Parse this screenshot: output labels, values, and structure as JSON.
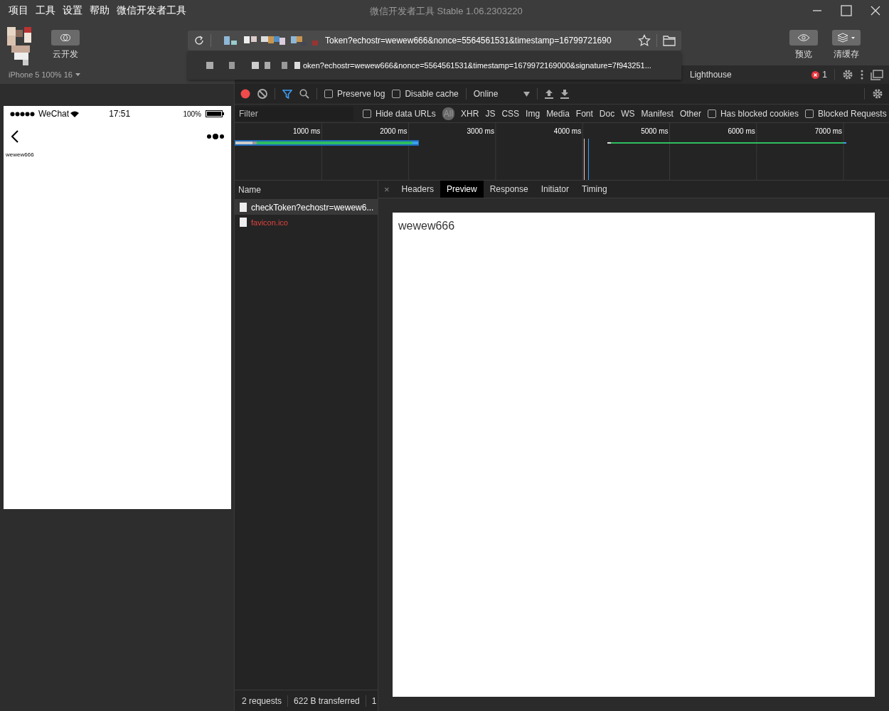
{
  "menu": [
    "项目",
    "工具",
    "设置",
    "帮助",
    "微信开发者工具"
  ],
  "window": {
    "title": "微信开发者工具 Stable 1.06.2303220"
  },
  "toolbar": {
    "cloud_button": "云开发",
    "preview_button": "预览",
    "clear_cache_button": "清缓存"
  },
  "address_bar": {
    "value": "Token?echostr=wewew666&nonce=5564561531&timestamp=16799721690",
    "suggestion": "oken?echostr=wewew666&nonce=5564561531&timestamp=1679972169000&signature=7f943251..."
  },
  "simulator": {
    "device": "iPhone 5 100% 16",
    "carrier": "WeChat",
    "time": "17:51",
    "battery": "100%",
    "page_text": "wewew666"
  },
  "devtools": {
    "tabs": [
      {
        "label": "Lighthouse"
      }
    ],
    "error_count": "1"
  },
  "network_toolbar": {
    "preserve_log": {
      "label": "Preserve log",
      "checked": false
    },
    "disable_cache": {
      "label": "Disable cache",
      "checked": false
    },
    "throttling": "Online"
  },
  "filter_bar": {
    "placeholder": "Filter",
    "hide_data_urls": {
      "label": "Hide data URLs",
      "checked": false
    },
    "types": [
      {
        "label": "All",
        "selected": true
      },
      {
        "label": "XHR",
        "selected": false
      },
      {
        "label": "JS",
        "selected": false
      },
      {
        "label": "CSS",
        "selected": false
      },
      {
        "label": "Img",
        "selected": false
      },
      {
        "label": "Media",
        "selected": false
      },
      {
        "label": "Font",
        "selected": false
      },
      {
        "label": "Doc",
        "selected": false
      },
      {
        "label": "WS",
        "selected": false
      },
      {
        "label": "Manifest",
        "selected": false
      },
      {
        "label": "Other",
        "selected": false
      }
    ],
    "has_blocked_cookies": {
      "label": "Has blocked cookies",
      "checked": false
    },
    "blocked_requests": {
      "label": "Blocked Requests",
      "checked": false
    }
  },
  "overview": {
    "ticks": [
      "1000 ms",
      "2000 ms",
      "3000 ms",
      "4000 ms",
      "5000 ms",
      "6000 ms",
      "7000 ms"
    ]
  },
  "requests": {
    "column": "Name",
    "rows": [
      {
        "name": "checkToken?echostr=wewew6...",
        "failed": false,
        "selected": true
      },
      {
        "name": "favicon.ico",
        "failed": true,
        "selected": false
      }
    ]
  },
  "detail": {
    "tabs": [
      {
        "label": "Headers",
        "selected": false
      },
      {
        "label": "Preview",
        "selected": true
      },
      {
        "label": "Response",
        "selected": false
      },
      {
        "label": "Initiator",
        "selected": false
      },
      {
        "label": "Timing",
        "selected": false
      }
    ],
    "close": "×",
    "preview_text": "wewew666"
  },
  "status_bar": [
    "2 requests",
    "622 B transferred",
    "1"
  ]
}
